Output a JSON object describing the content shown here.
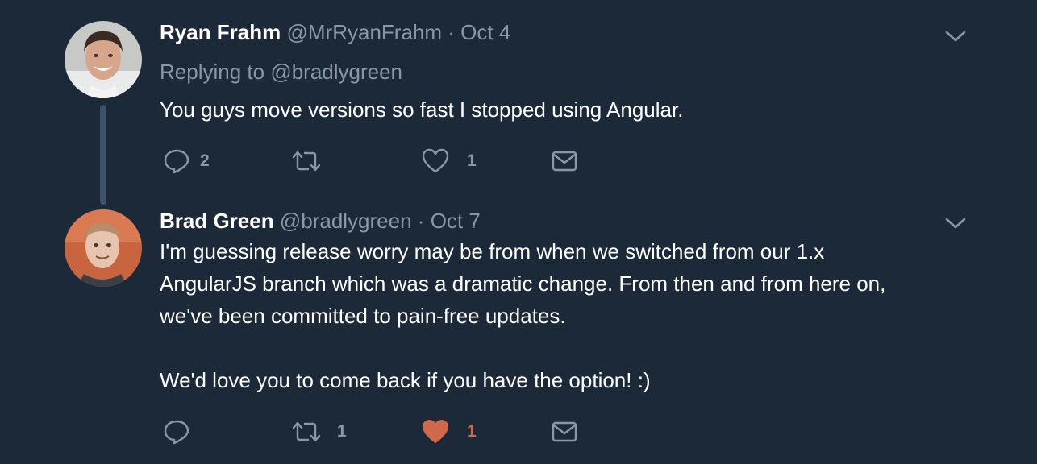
{
  "tweets": [
    {
      "name": "Ryan Frahm",
      "handle": "@MrRyanFrahm",
      "separator": "·",
      "date": "Oct 4",
      "replying_label": "Replying to",
      "replying_handle": "@bradlygreen",
      "text": [
        "You guys move versions so fast I stopped using Angular."
      ],
      "actions": {
        "reply_count": "2",
        "retweet_count": "",
        "like_count": "1",
        "liked": false
      }
    },
    {
      "name": "Brad Green",
      "handle": "@bradlygreen",
      "separator": "·",
      "date": "Oct 7",
      "text": [
        "I'm guessing release worry may be from when we switched from our 1.x",
        "AngularJS branch which was a dramatic change. From then and from here on,",
        "we've been committed to pain-free updates.",
        "",
        "We'd love you to come back if you have the option! :)"
      ],
      "actions": {
        "reply_count": "",
        "retweet_count": "1",
        "like_count": "1",
        "liked": true
      }
    }
  ],
  "colors": {
    "background": "#1c2938",
    "text_primary": "#ffffff",
    "text_secondary": "#8899a6",
    "like_active": "#d0694a",
    "thread_line": "#3d5466"
  }
}
